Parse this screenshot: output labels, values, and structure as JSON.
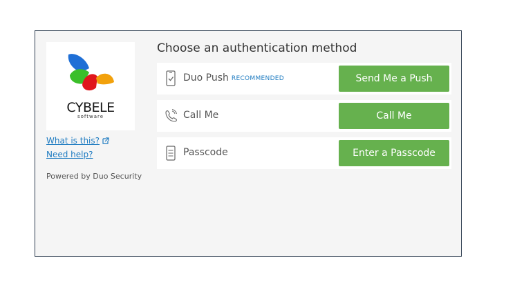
{
  "sidebar": {
    "logo_text": "CYBELE",
    "logo_sub": "software",
    "what_is_this": "What is this?",
    "need_help": "Need help?",
    "powered_by": "Powered by Duo Security"
  },
  "main": {
    "heading": "Choose an authentication method",
    "methods": [
      {
        "label": "Duo Push",
        "badge": "RECOMMENDED",
        "button": "Send Me a Push",
        "icon": "phone-push-icon"
      },
      {
        "label": "Call Me",
        "badge": "",
        "button": "Call Me",
        "icon": "phone-call-icon"
      },
      {
        "label": "Passcode",
        "badge": "",
        "button": "Enter a Passcode",
        "icon": "passcode-icon"
      }
    ]
  },
  "colors": {
    "button_green": "#66b14e",
    "link_blue": "#1e7bc1",
    "panel_bg": "#f5f5f5",
    "border": "#2b3b4e"
  }
}
